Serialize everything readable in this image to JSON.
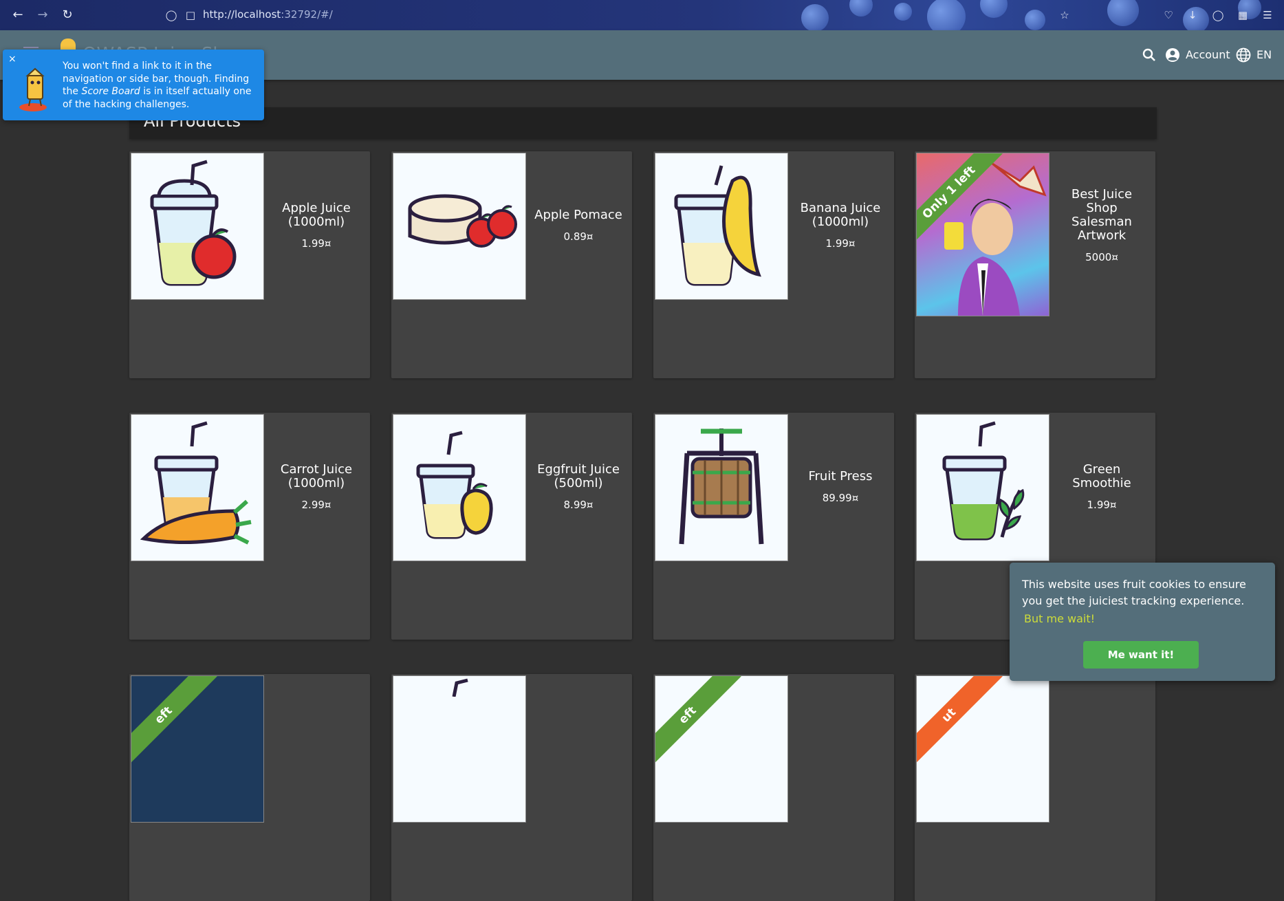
{
  "browser": {
    "url_host": "http://localhost",
    "url_rest": ":32792/#/"
  },
  "toolbar": {
    "app_title": "OWASP Juice Shop",
    "account_label": "Account",
    "language_label": "EN"
  },
  "tip": {
    "close": "×",
    "text_1": "You won't find a link to it in the navigation or side bar, though. Finding the ",
    "text_em": "Score Board",
    "text_2": " is in itself actually one of the hacking challenges."
  },
  "page": {
    "heading": "All Products"
  },
  "products": [
    {
      "name": "Apple Juice (1000ml)",
      "price": "1.99¤"
    },
    {
      "name": "Apple Pomace",
      "price": "0.89¤"
    },
    {
      "name": "Banana Juice (1000ml)",
      "price": "1.99¤"
    },
    {
      "name": "Best Juice Shop Salesman Artwork",
      "price": "5000¤",
      "ribbon": "Only 1 left"
    },
    {
      "name": "Carrot Juice (1000ml)",
      "price": "2.99¤"
    },
    {
      "name": "Eggfruit Juice (500ml)",
      "price": "8.99¤"
    },
    {
      "name": "Fruit Press",
      "price": "89.99¤"
    },
    {
      "name": "Green Smoothie",
      "price": "1.99¤"
    },
    {
      "ribbon": "eft"
    },
    {},
    {
      "ribbon": "eft"
    },
    {
      "ribbon": "ut"
    }
  ],
  "cookie": {
    "message": "This website uses fruit cookies to ensure you get the juiciest tracking experience.",
    "link": "But me wait!",
    "button": "Me want it!"
  },
  "colors": {
    "toolbar": "#546e7a",
    "tip": "#1e88e5",
    "ribbon_green": "#5a9e3a",
    "ribbon_orange": "#f0632a",
    "cookie_button": "#4caf50",
    "cookie_link": "#cddc39"
  }
}
